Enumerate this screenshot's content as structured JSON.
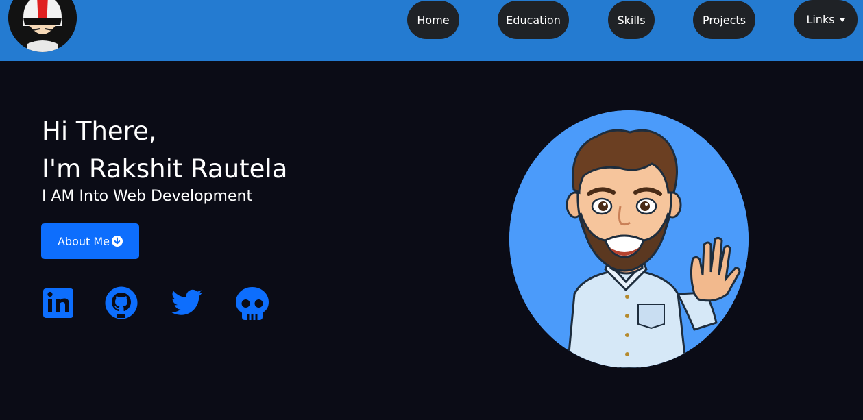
{
  "nav": {
    "items": [
      {
        "label": "Home"
      },
      {
        "label": "Education"
      },
      {
        "label": "Skills"
      },
      {
        "label": "Projects"
      }
    ],
    "dropdown_label": "Links"
  },
  "hero": {
    "greeting_line1": "Hi There,",
    "greeting_line2": "I'm Rakshit Rautela",
    "tagline": "I AM Into Web Development",
    "about_button": "About Me"
  },
  "social_icons": [
    "linkedin-icon",
    "github-icon",
    "twitter-icon",
    "skull-icon"
  ],
  "colors": {
    "navbar": "#247bd1",
    "background": "#0b0c16",
    "nav_pill": "#1f2226",
    "accent": "#0d6efd",
    "avatar_bg": "#4b9bfa"
  }
}
